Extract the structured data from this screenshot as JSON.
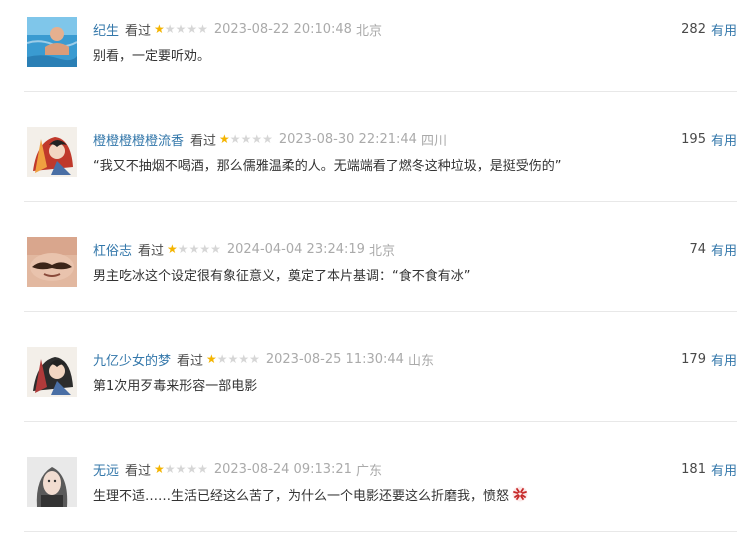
{
  "comments": [
    {
      "username": "纪生",
      "status": "看过",
      "rating_stars": 1,
      "rating_max": 5,
      "time": "2023-08-22 20:10:48",
      "location": "北京",
      "votes": "282",
      "useful_label": "有用",
      "text": "别看，一定要听劝。",
      "avatar_icon": "swimming-person-avatar",
      "avatar_colors": [
        "#3a9bd1",
        "#7fc6ea"
      ]
    },
    {
      "username": "橙橙橙橙橙流香",
      "status": "看过",
      "rating_stars": 1,
      "rating_max": 5,
      "time": "2023-08-30 22:21:44",
      "location": "四川",
      "votes": "195",
      "useful_label": "有用",
      "text": "“我又不抽烟不喝酒，那么儒雅温柔的人。无端端看了燃冬这种垃圾，是挺受伤的”",
      "avatar_icon": "anime-character-avatar",
      "avatar_colors": [
        "#c0392b",
        "#f0a040"
      ]
    },
    {
      "username": "杠俗志",
      "status": "看过",
      "rating_stars": 1,
      "rating_max": 5,
      "time": "2024-04-04 23:24:19",
      "location": "北京",
      "votes": "74",
      "useful_label": "有用",
      "text": "男主吃冰这个设定很有象征意义，奠定了本片基调：“食不食有冰”",
      "avatar_icon": "mustache-face-avatar",
      "avatar_colors": [
        "#e2b8a0",
        "#3b2418"
      ]
    },
    {
      "username": "九亿少女的梦",
      "status": "看过",
      "rating_stars": 1,
      "rating_max": 5,
      "time": "2023-08-25 11:30:44",
      "location": "山东",
      "votes": "179",
      "useful_label": "有用",
      "text": "第1次用歹毒来形容一部电影",
      "avatar_icon": "anime-character-avatar",
      "avatar_colors": [
        "#2c2c2c",
        "#b03a3a"
      ]
    },
    {
      "username": "无远",
      "status": "看过",
      "rating_stars": 1,
      "rating_max": 5,
      "time": "2023-08-24 09:13:21",
      "location": "广东",
      "votes": "181",
      "useful_label": "有用",
      "text": "生理不适……生活已经这么苦了，为什么一个电影还要这么折磨我，愤怒",
      "text_emoji": "anger-icon",
      "avatar_icon": "woman-portrait-avatar",
      "avatar_colors": [
        "#cfcfcf",
        "#5a5a5a"
      ]
    }
  ]
}
